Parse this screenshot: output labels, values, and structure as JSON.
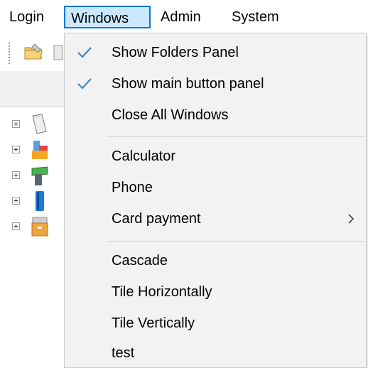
{
  "menubar": {
    "items": [
      {
        "label": "Login"
      },
      {
        "label": "Windows"
      },
      {
        "label": "Admin"
      },
      {
        "label": "System"
      }
    ]
  },
  "windows_menu": {
    "items": [
      {
        "label": "Show Folders Panel",
        "checked": true
      },
      {
        "label": "Show main button panel",
        "checked": true
      },
      {
        "label": "Close All Windows"
      },
      {
        "label": "Calculator"
      },
      {
        "label": "Phone"
      },
      {
        "label": "Card payment",
        "has_submenu": true
      },
      {
        "label": "Cascade"
      },
      {
        "label": "Tile Horizontally"
      },
      {
        "label": "Tile Vertically"
      },
      {
        "label": "test"
      }
    ]
  },
  "tree": {
    "nodes": [
      {
        "icon": "document-icon"
      },
      {
        "icon": "products-icon"
      },
      {
        "icon": "pos-terminal-icon"
      },
      {
        "icon": "card-icon"
      },
      {
        "icon": "archive-box-icon"
      }
    ]
  },
  "colors": {
    "menu_highlight_bg": "#cce8ff",
    "menu_highlight_border": "#0078d7",
    "check_color": "#3a86c8",
    "dropdown_bg": "#f2f2f2"
  }
}
